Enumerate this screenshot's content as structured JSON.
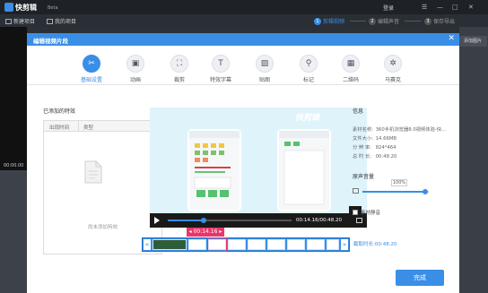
{
  "app": {
    "name": "快剪辑",
    "beta": "Beta",
    "login": "登录",
    "window_controls": [
      "☰",
      "—",
      "□",
      "✕"
    ],
    "accent_color": "#3a8ee6",
    "highlight_color": "#e8366b"
  },
  "toolbar": {
    "new_project": "新建项目",
    "my_projects": "我的项目",
    "steps": [
      {
        "num": "1",
        "label": "剪辑视频",
        "active": true
      },
      {
        "num": "2",
        "label": "编辑声音",
        "active": false
      },
      {
        "num": "3",
        "label": "保存导出",
        "active": false
      }
    ]
  },
  "background": {
    "time": "00:00.00",
    "right_button": "添加图片"
  },
  "modal": {
    "title": "编辑视频片段",
    "close": "✕",
    "tabs": [
      {
        "label": "基础设置",
        "icon": "scissors-icon",
        "glyph": "✂",
        "active": true
      },
      {
        "label": "动画",
        "icon": "animation-icon",
        "glyph": "▣",
        "active": false
      },
      {
        "label": "裁剪",
        "icon": "crop-icon",
        "glyph": "⛶",
        "active": false
      },
      {
        "label": "特效字幕",
        "icon": "text-icon",
        "glyph": "T",
        "active": false
      },
      {
        "label": "贴图",
        "icon": "image-icon",
        "glyph": "▨",
        "active": false
      },
      {
        "label": "标记",
        "icon": "pin-icon",
        "glyph": "⚲",
        "active": false
      },
      {
        "label": "二维码",
        "icon": "qrcode-icon",
        "glyph": "▦",
        "active": false
      },
      {
        "label": "马赛克",
        "icon": "mosaic-icon",
        "glyph": "✲",
        "active": false
      }
    ],
    "effects": {
      "title": "已添加的特效",
      "col_time": "出现时间",
      "col_type": "类型",
      "empty_text": "尚未添加特效"
    },
    "player": {
      "brand": "快剪辑",
      "time": "00:14.16/00:48.20",
      "progress": 0.29
    },
    "timeline": {
      "current_tag": "◂ 00:14.16 ▸",
      "duration_label": "截取时长:00:48.20",
      "left_arrow": "«",
      "right_arrow": "»"
    },
    "info": {
      "title": "信息",
      "rows": [
        {
          "key": "素材名称:",
          "value": "360手机浏览器8.0视频体验-快..."
        },
        {
          "key": "文件大小:",
          "value": "14.66MB"
        },
        {
          "key": "分 辨 率:",
          "value": "824*464"
        },
        {
          "key": "总 时 长:",
          "value": "00:48.20"
        }
      ]
    },
    "volume": {
      "title": "原声音量",
      "percent": "100%",
      "level": 0.94,
      "mute_label": "素材静音"
    },
    "done_button": "完成"
  }
}
